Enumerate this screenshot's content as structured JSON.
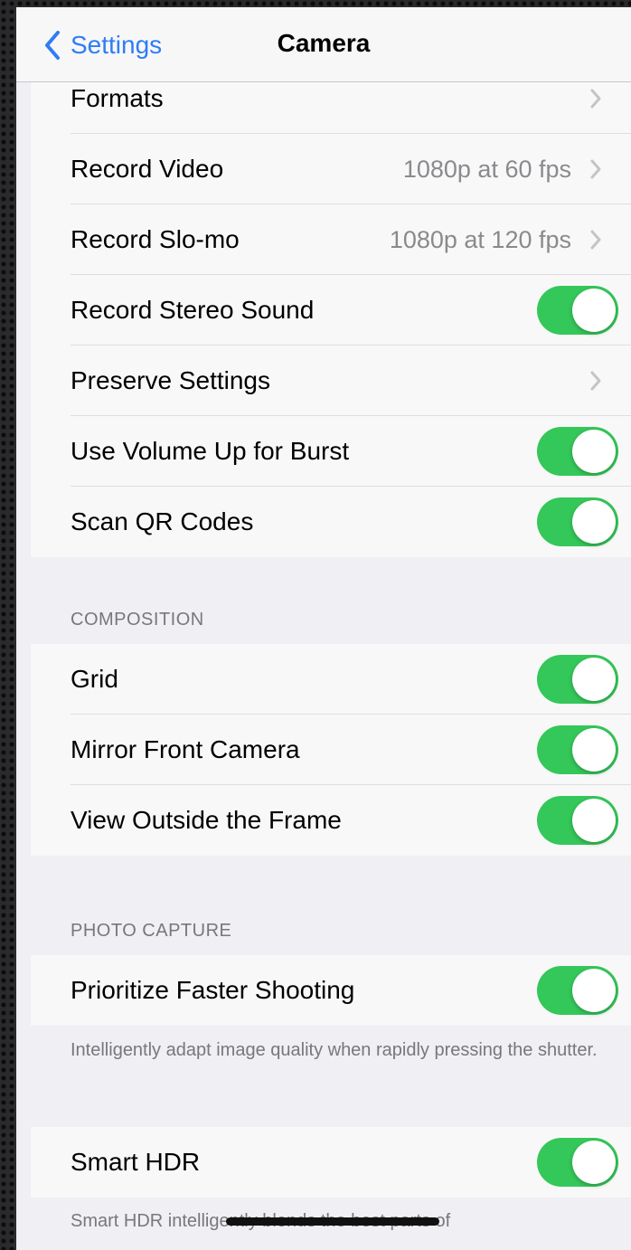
{
  "navbar": {
    "back_label": "Settings",
    "title": "Camera"
  },
  "group1": [
    {
      "label": "Formats",
      "value": "",
      "control": "chevron"
    },
    {
      "label": "Record Video",
      "value": "1080p at 60 fps",
      "control": "chevron"
    },
    {
      "label": "Record Slo-mo",
      "value": "1080p at 120 fps",
      "control": "chevron"
    },
    {
      "label": "Record Stereo Sound",
      "value": "",
      "control": "toggle",
      "on": true
    },
    {
      "label": "Preserve Settings",
      "value": "",
      "control": "chevron"
    },
    {
      "label": "Use Volume Up for Burst",
      "value": "",
      "control": "toggle",
      "on": true
    },
    {
      "label": "Scan QR Codes",
      "value": "",
      "control": "toggle",
      "on": true
    }
  ],
  "composition": {
    "header": "COMPOSITION",
    "rows": [
      {
        "label": "Grid",
        "control": "toggle",
        "on": true
      },
      {
        "label": "Mirror Front Camera",
        "control": "toggle",
        "on": true
      },
      {
        "label": "View Outside the Frame",
        "control": "toggle",
        "on": true
      }
    ]
  },
  "photo_capture": {
    "header": "PHOTO CAPTURE",
    "rows": [
      {
        "label": "Prioritize Faster Shooting",
        "control": "toggle",
        "on": true
      }
    ],
    "footer": "Intelligently adapt image quality when rapidly pressing the shutter."
  },
  "hdr": {
    "rows": [
      {
        "label": "Smart HDR",
        "control": "toggle",
        "on": true
      }
    ],
    "footer": "Smart HDR intelligently blends the best parts of"
  },
  "colors": {
    "accent": "#2f7cf6",
    "toggle_on": "#34c759",
    "secondary_text": "#8a8a8e"
  },
  "icons": {
    "back": "chevron-left-icon",
    "disclosure": "chevron-right-icon"
  }
}
